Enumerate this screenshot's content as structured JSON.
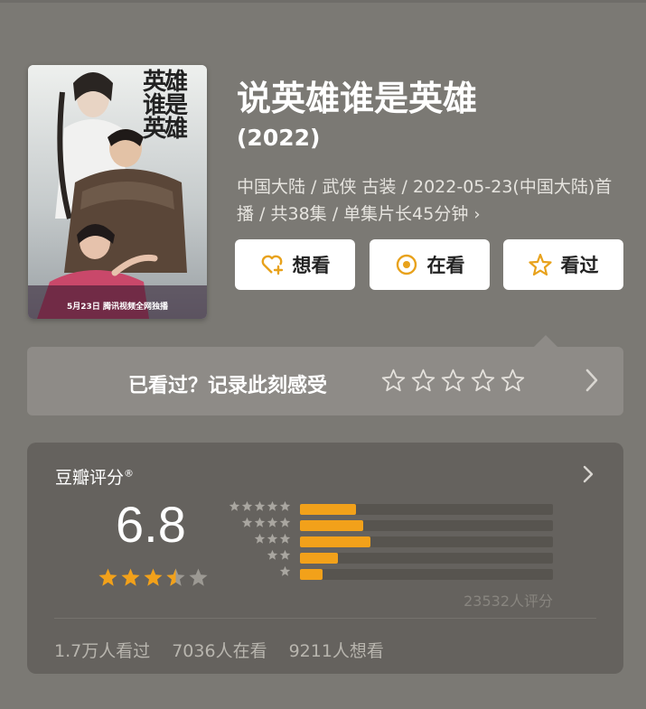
{
  "poster": {
    "title_art": "英雄 谁是 英雄",
    "caption": "5月23日 腾讯视频全网独播"
  },
  "show": {
    "title": "说英雄谁是英雄",
    "year": "(2022)",
    "meta": "中国大陆 / 武侠 古装 / 2022-05-23(中国大陆)首播 / 共38集 / 单集片长45分钟"
  },
  "actions": {
    "want": "想看",
    "watching": "在看",
    "watched": "看过"
  },
  "record": {
    "label": "已看过？记录此刻感受",
    "star_count": 5
  },
  "rating": {
    "title": "豆瓣评分",
    "registered": "®",
    "score": "6.8",
    "stars": 3.5,
    "distribution": [
      {
        "stars": 5,
        "fraction": 0.22
      },
      {
        "stars": 4,
        "fraction": 0.25
      },
      {
        "stars": 3,
        "fraction": 0.28
      },
      {
        "stars": 2,
        "fraction": 0.15
      },
      {
        "stars": 1,
        "fraction": 0.09
      }
    ],
    "count": "23532人评分",
    "stats": {
      "watched": "1.7万人看过",
      "watching": "7036人在看",
      "want": "9211人想看"
    }
  },
  "colors": {
    "background": "#7b7974",
    "card": "#65625e",
    "accent": "#f2a11a"
  }
}
